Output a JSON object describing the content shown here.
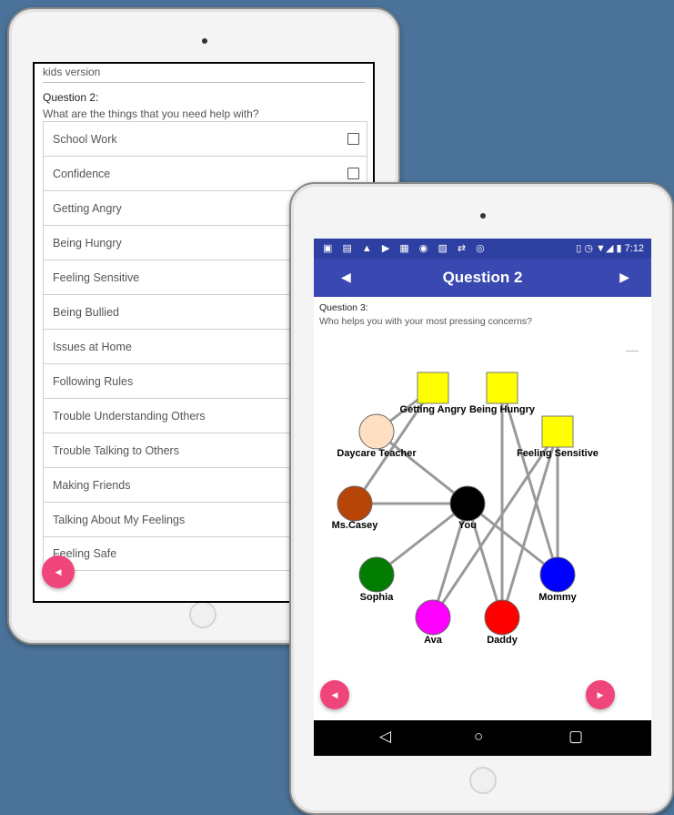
{
  "tablet_left": {
    "header_text": "kids version",
    "question_label": "Question 2:",
    "question_text": "What are the things that you need help with?",
    "options": [
      "School Work",
      "Confidence",
      "Getting Angry",
      "Being Hungry",
      "Feeling Sensitive",
      "Being Bullied",
      "Issues at Home",
      "Following Rules",
      "Trouble Understanding Others",
      "Trouble Talking to Others",
      "Making Friends",
      "Talking About My Feelings",
      "Feeling Safe"
    ],
    "prev_button_icon": "chevron-left-icon"
  },
  "tablet_right": {
    "status_bar": {
      "left_icons": [
        "calendar-icon",
        "mail-icon",
        "notification-icon",
        "youtube-icon",
        "word-icon",
        "messenger-icon",
        "gallery-icon",
        "transfer-icon",
        "instagram-icon"
      ],
      "right_icons": [
        "vibrate-icon",
        "alarm-icon",
        "wifi-icon",
        "signal-icon",
        "battery-icon"
      ],
      "time": "7:12"
    },
    "app_bar": {
      "title": "Question 2",
      "prev_icon": "triangle-left-icon",
      "next_icon": "triangle-right-icon"
    },
    "question_label": "Question 3:",
    "question_text": "Who helps you with your most pressing concerns?",
    "graph": {
      "concerns": [
        {
          "id": "angry",
          "label": "Getting Angry",
          "color": "#ffff00"
        },
        {
          "id": "hungry",
          "label": "Being Hungry",
          "color": "#ffff00"
        },
        {
          "id": "sensitive",
          "label": "Feeling Sensitive",
          "color": "#ffff00"
        }
      ],
      "people": [
        {
          "id": "teacher",
          "label": "Daycare Teacher",
          "color": "#ffdfc2"
        },
        {
          "id": "casey",
          "label": "Ms.Casey",
          "color": "#b84508"
        },
        {
          "id": "you",
          "label": "You",
          "color": "#000000"
        },
        {
          "id": "sophia",
          "label": "Sophia",
          "color": "#027d02"
        },
        {
          "id": "mommy",
          "label": "Mommy",
          "color": "#0000ff"
        },
        {
          "id": "ava",
          "label": "Ava",
          "color": "#ff00ff"
        },
        {
          "id": "daddy",
          "label": "Daddy",
          "color": "#ff0000"
        }
      ],
      "edges": [
        [
          "angry",
          "teacher"
        ],
        [
          "teacher",
          "you"
        ],
        [
          "casey",
          "you"
        ],
        [
          "casey",
          "angry"
        ],
        [
          "you",
          "sophia"
        ],
        [
          "you",
          "ava"
        ],
        [
          "you",
          "daddy"
        ],
        [
          "you",
          "mommy"
        ],
        [
          "hungry",
          "daddy"
        ],
        [
          "hungry",
          "mommy"
        ],
        [
          "sensitive",
          "mommy"
        ],
        [
          "sensitive",
          "ava"
        ],
        [
          "sensitive",
          "daddy"
        ]
      ],
      "edge_color": "#999999"
    },
    "prev_button_icon": "chevron-left-icon",
    "next_button_icon": "chevron-right-icon",
    "nav_bar": {
      "back_icon": "back-triangle-icon",
      "home_icon": "home-circle-icon",
      "recents_icon": "recents-square-icon"
    }
  }
}
